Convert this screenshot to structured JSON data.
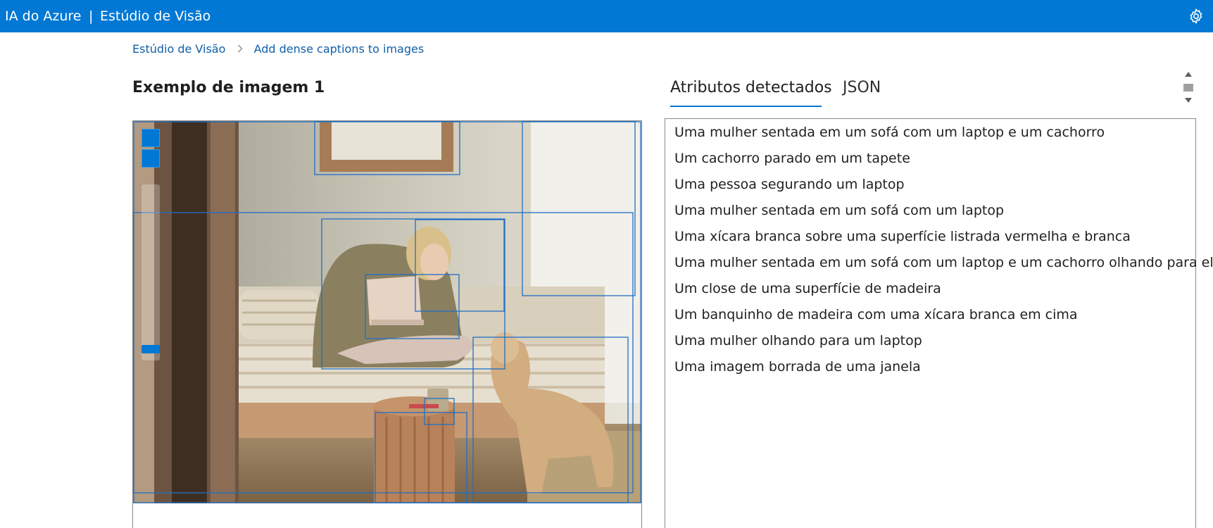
{
  "header": {
    "brand": "IA do Azure",
    "separator": "|",
    "product": "Estúdio de Visão",
    "settings_icon": "gear-icon"
  },
  "breadcrumb": {
    "items": [
      "Estúdio de Visão",
      "Add dense captions to images"
    ],
    "separator_icon": "chevron-right-icon"
  },
  "left_panel": {
    "title": "Exemplo de imagem 1",
    "zoom_in_icon": "zoom-in-icon",
    "zoom_out_icon": "zoom-out-icon"
  },
  "right_panel": {
    "tabs": [
      {
        "label": "Atributos detectados",
        "active": true
      },
      {
        "label": "JSON",
        "active": false
      }
    ],
    "captions": [
      "Uma mulher sentada em um sofá com um laptop e um cachorro",
      "Um cachorro parado em um tapete",
      "Uma pessoa segurando um laptop",
      "Uma mulher sentada em um sofá com um laptop",
      "Uma xícara branca sobre uma superfície listrada vermelha e branca",
      "Uma mulher sentada em um sofá com um laptop e um cachorro olhando para ele",
      "Um close de uma superfície de madeira",
      "Um banquinho de madeira com uma xícara branca em cima",
      "Uma mulher olhando para um laptop",
      "Uma imagem borrada de uma janela"
    ]
  },
  "colors": {
    "header_bg": "#0078d4",
    "accent": "#0078d4",
    "link": "#0f5fa8",
    "bbox_stroke": "#1f6fc5"
  }
}
